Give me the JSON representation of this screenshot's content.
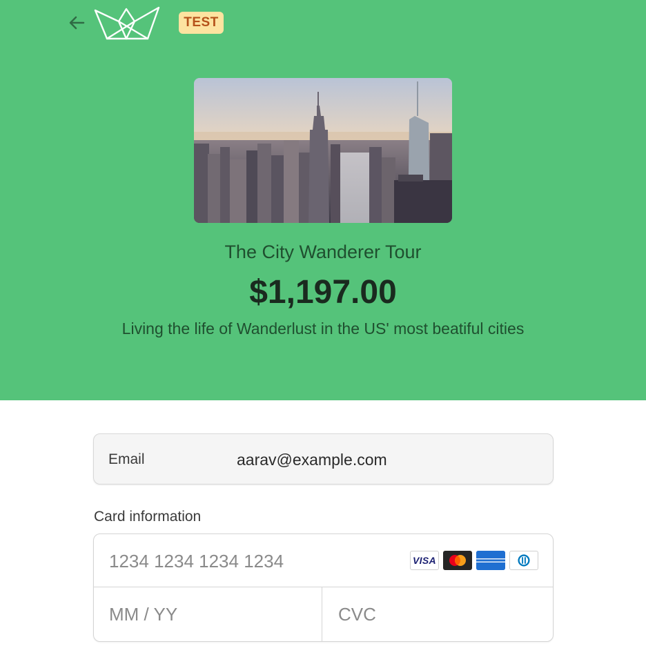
{
  "header": {
    "back_icon": "arrow-left-icon",
    "logo_icon": "crown-logo",
    "badge": "TEST"
  },
  "colors": {
    "hero_background": "#55c37a",
    "badge_background": "#fde3a0",
    "badge_text": "#b5521a"
  },
  "product": {
    "image": "city-skyline-photo",
    "name": "The City Wanderer Tour",
    "price": "$1,197.00",
    "description": "Living the life of Wanderlust in the US' most beatiful cities"
  },
  "form": {
    "email_label": "Email",
    "email_value": "aarav@example.com",
    "card_label": "Card information",
    "card_number_placeholder": "1234 1234 1234 1234",
    "expiry_placeholder": "MM / YY",
    "cvc_placeholder": "CVC",
    "card_brands": [
      "visa-icon",
      "mastercard-icon",
      "amex-icon",
      "diners-icon"
    ],
    "visa_text": "VISA"
  }
}
